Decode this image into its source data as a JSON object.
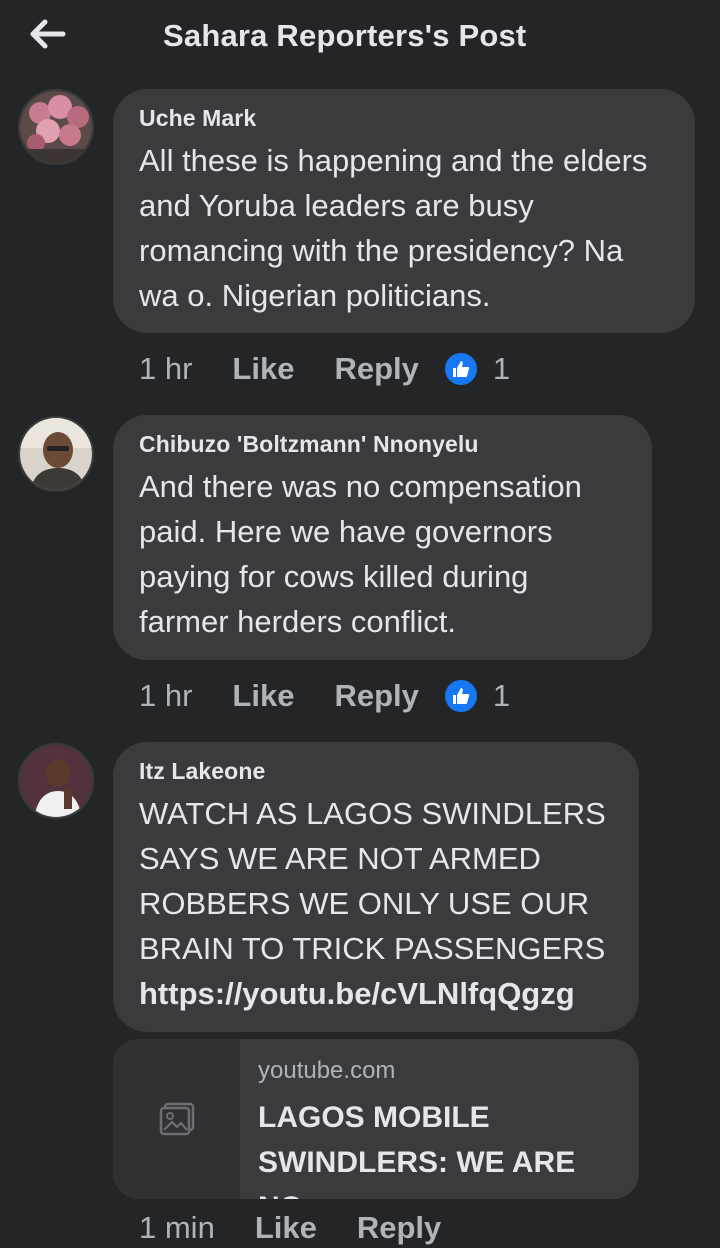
{
  "header": {
    "title": "Sahara Reporters's Post",
    "back_icon": "arrow-left-icon"
  },
  "comments": [
    {
      "name": "Uche Mark",
      "text": "All these is happening and the elders and Yoruba leaders are busy romancing with the presidency? Na wa o. Nigerian politicians.",
      "time": "1 hr",
      "like_label": "Like",
      "reply_label": "Reply",
      "reaction_count": "1"
    },
    {
      "name": "Chibuzo 'Boltzmann' Nnonyelu",
      "text": "And there was no compensation paid. Here we have governors paying for cows killed during farmer herders conflict.",
      "time": "1 hr",
      "like_label": "Like",
      "reply_label": "Reply",
      "reaction_count": "1"
    },
    {
      "name": "Itz Lakeone",
      "text": "WATCH AS LAGOS SWINDLERS SAYS WE ARE NOT ARMED ROBBERS WE ONLY USE OUR BRAIN TO TRICK PASSENGERS",
      "link": "https://youtu.be/cVLNlfqQgzg",
      "preview": {
        "domain": "youtube.com",
        "title": "LAGOS MOBILE SWINDLERS: WE ARE NO..."
      },
      "time": "1 min",
      "like_label": "Like",
      "reply_label": "Reply"
    }
  ],
  "colors": {
    "background": "#242526",
    "bubble": "#3a3b3c",
    "text": "#e4e6eb",
    "muted": "#b0b3b8",
    "like_blue": "#1877f2"
  }
}
